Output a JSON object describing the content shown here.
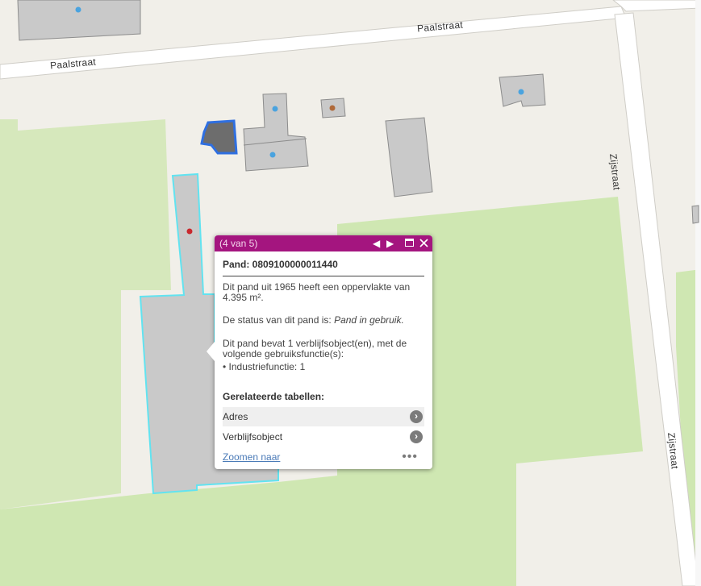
{
  "map": {
    "road_labels": {
      "paalstraat_top": "Paalstraat",
      "paalstraat_left": "Paalstraat",
      "zijstraat_top": "Zijstraat",
      "zijstraat_bottom": "Zijstraat"
    },
    "colors": {
      "background": "#f1efe9",
      "road": "#ffffff",
      "road_edge": "#c8c6c0",
      "park": "#cfe7b2",
      "building": "#c9c9c9",
      "building_edge": "#8c8c8c",
      "selected_outline": "#62e3f0",
      "highlight_outline": "#2f6fe0",
      "dot_blue": "#4aa3df",
      "dot_brown": "#b06a3a",
      "dot_red": "#c9282d"
    }
  },
  "popup": {
    "counter": "(4 van 5)",
    "header_color": "#a4157f",
    "title": "Pand: 0809100000011440",
    "para1": "Dit pand uit 1965 heeft een oppervlakte van 4.395 m².",
    "para2_prefix": "De status van dit pand is: ",
    "para2_status": "Pand in gebruik.",
    "para3": "Dit pand bevat 1 verblijfsobject(en), met de volgende gebruiksfunctie(s):",
    "para3_item": "• Industriefunctie: 1",
    "related_heading": "Gerelateerde tabellen:",
    "related": [
      {
        "label": "Adres"
      },
      {
        "label": "Verblijfsobject"
      }
    ],
    "zoom_link": "Zoomen naar",
    "more": "•••",
    "icons": {
      "prev": "prev-icon",
      "next": "next-icon",
      "maximize": "maximize-icon",
      "close": "close-icon",
      "chevron": "chevron-right-icon"
    }
  }
}
